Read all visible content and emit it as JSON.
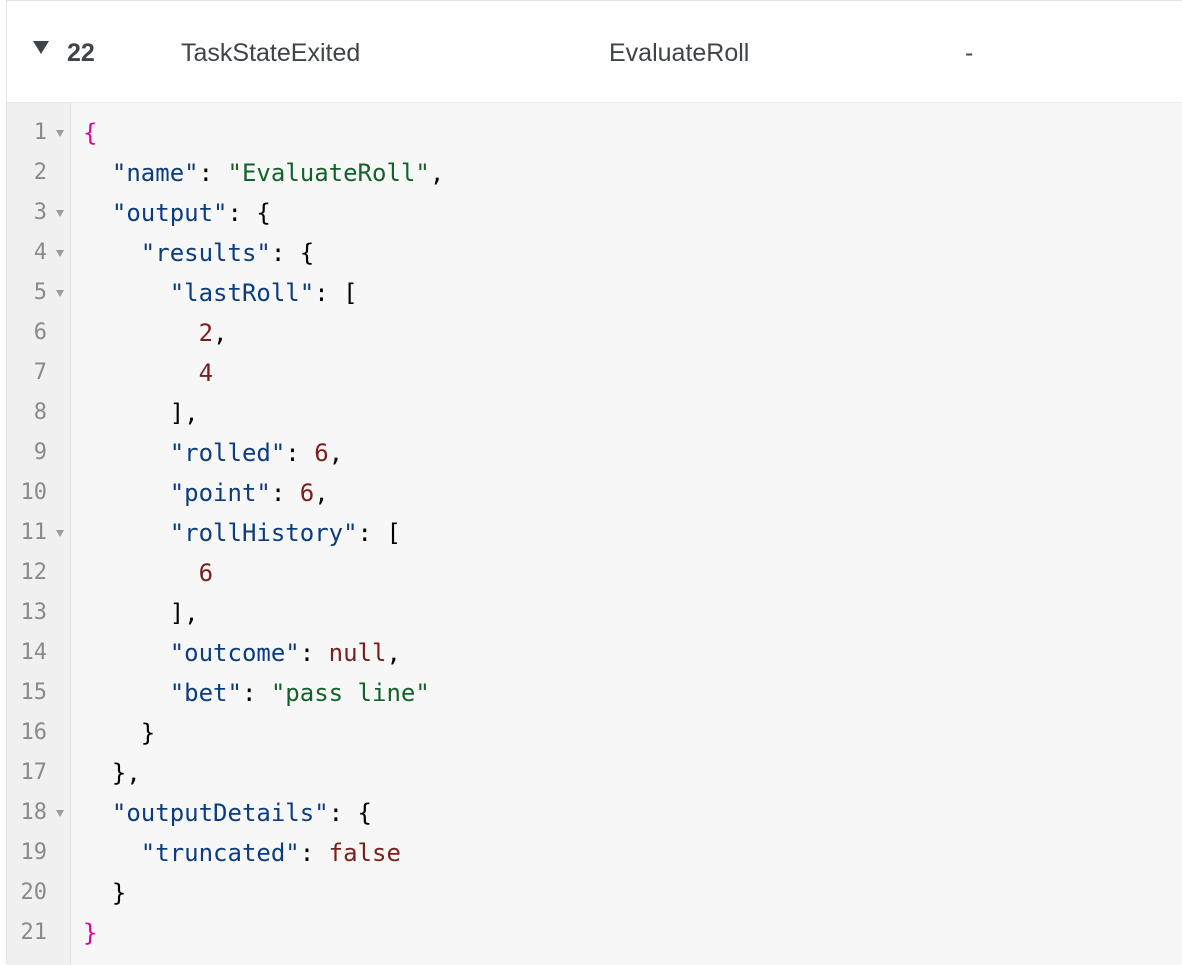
{
  "event": {
    "id": "22",
    "type": "TaskStateExited",
    "step": "EvaluateRoll",
    "dash": "-"
  },
  "json_lines": [
    {
      "num": "1",
      "fold": true,
      "segments": [
        {
          "t": "{",
          "c": "pb"
        }
      ]
    },
    {
      "num": "2",
      "fold": false,
      "segments": [
        {
          "t": "  "
        },
        {
          "t": "\"name\"",
          "c": "k"
        },
        {
          "t": ": "
        },
        {
          "t": "\"EvaluateRoll\"",
          "c": "s"
        },
        {
          "t": ","
        }
      ]
    },
    {
      "num": "3",
      "fold": true,
      "segments": [
        {
          "t": "  "
        },
        {
          "t": "\"output\"",
          "c": "k"
        },
        {
          "t": ": {"
        }
      ]
    },
    {
      "num": "4",
      "fold": true,
      "segments": [
        {
          "t": "    "
        },
        {
          "t": "\"results\"",
          "c": "k"
        },
        {
          "t": ": {"
        }
      ]
    },
    {
      "num": "5",
      "fold": true,
      "segments": [
        {
          "t": "      "
        },
        {
          "t": "\"lastRoll\"",
          "c": "k"
        },
        {
          "t": ": ["
        }
      ]
    },
    {
      "num": "6",
      "fold": false,
      "segments": [
        {
          "t": "        "
        },
        {
          "t": "2",
          "c": "n"
        },
        {
          "t": ","
        }
      ]
    },
    {
      "num": "7",
      "fold": false,
      "segments": [
        {
          "t": "        "
        },
        {
          "t": "4",
          "c": "n"
        }
      ]
    },
    {
      "num": "8",
      "fold": false,
      "segments": [
        {
          "t": "      ],"
        }
      ]
    },
    {
      "num": "9",
      "fold": false,
      "segments": [
        {
          "t": "      "
        },
        {
          "t": "\"rolled\"",
          "c": "k"
        },
        {
          "t": ": "
        },
        {
          "t": "6",
          "c": "n"
        },
        {
          "t": ","
        }
      ]
    },
    {
      "num": "10",
      "fold": false,
      "segments": [
        {
          "t": "      "
        },
        {
          "t": "\"point\"",
          "c": "k"
        },
        {
          "t": ": "
        },
        {
          "t": "6",
          "c": "n"
        },
        {
          "t": ","
        }
      ]
    },
    {
      "num": "11",
      "fold": true,
      "segments": [
        {
          "t": "      "
        },
        {
          "t": "\"rollHistory\"",
          "c": "k"
        },
        {
          "t": ": ["
        }
      ]
    },
    {
      "num": "12",
      "fold": false,
      "segments": [
        {
          "t": "        "
        },
        {
          "t": "6",
          "c": "n"
        }
      ]
    },
    {
      "num": "13",
      "fold": false,
      "segments": [
        {
          "t": "      ],"
        }
      ]
    },
    {
      "num": "14",
      "fold": false,
      "segments": [
        {
          "t": "      "
        },
        {
          "t": "\"outcome\"",
          "c": "k"
        },
        {
          "t": ": "
        },
        {
          "t": "null",
          "c": "n"
        },
        {
          "t": ","
        }
      ]
    },
    {
      "num": "15",
      "fold": false,
      "segments": [
        {
          "t": "      "
        },
        {
          "t": "\"bet\"",
          "c": "k"
        },
        {
          "t": ": "
        },
        {
          "t": "\"pass line\"",
          "c": "s"
        }
      ]
    },
    {
      "num": "16",
      "fold": false,
      "segments": [
        {
          "t": "    }"
        }
      ]
    },
    {
      "num": "17",
      "fold": false,
      "segments": [
        {
          "t": "  },"
        }
      ]
    },
    {
      "num": "18",
      "fold": true,
      "segments": [
        {
          "t": "  "
        },
        {
          "t": "\"outputDetails\"",
          "c": "k"
        },
        {
          "t": ": {"
        }
      ]
    },
    {
      "num": "19",
      "fold": false,
      "segments": [
        {
          "t": "    "
        },
        {
          "t": "\"truncated\"",
          "c": "k"
        },
        {
          "t": ": "
        },
        {
          "t": "false",
          "c": "n"
        }
      ]
    },
    {
      "num": "20",
      "fold": false,
      "segments": [
        {
          "t": "  }"
        }
      ]
    },
    {
      "num": "21",
      "fold": false,
      "segments": [
        {
          "t": "}",
          "c": "pb"
        }
      ]
    }
  ]
}
